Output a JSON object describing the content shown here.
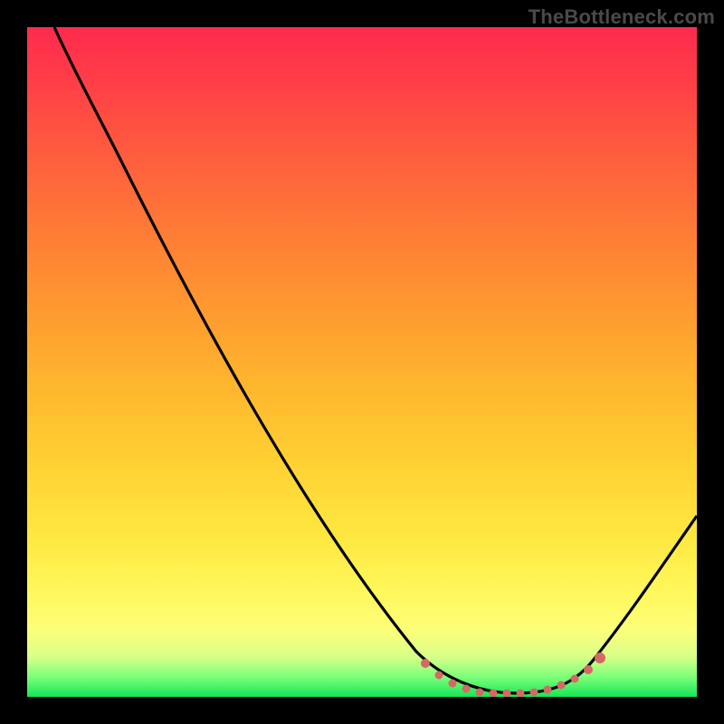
{
  "watermark": "TheBottleneck.com",
  "colors": {
    "background": "#000000",
    "gradient_top": "#ff2a4d",
    "gradient_mid": "#ffd333",
    "gradient_bottom": "#15e657",
    "curve": "#000000",
    "marker": "#d46a63"
  },
  "chart_data": {
    "type": "line",
    "title": "",
    "xlabel": "",
    "ylabel": "",
    "xlim": [
      0,
      100
    ],
    "ylim": [
      0,
      100
    ],
    "grid": false,
    "legend": false,
    "series": [
      {
        "name": "bottleneck-curve",
        "x": [
          4,
          8,
          14,
          24,
          40,
          58,
          63,
          68,
          73,
          78,
          82,
          85,
          90,
          95,
          100
        ],
        "values": [
          100,
          92,
          80,
          60,
          29,
          7,
          3,
          0.5,
          0.5,
          0.5,
          3,
          6,
          12,
          20,
          27
        ]
      }
    ],
    "annotations": [
      {
        "name": "optimal-flat-region",
        "style": "dotted-red",
        "x_range": [
          59,
          86
        ],
        "y_approx": 0.5
      }
    ]
  }
}
